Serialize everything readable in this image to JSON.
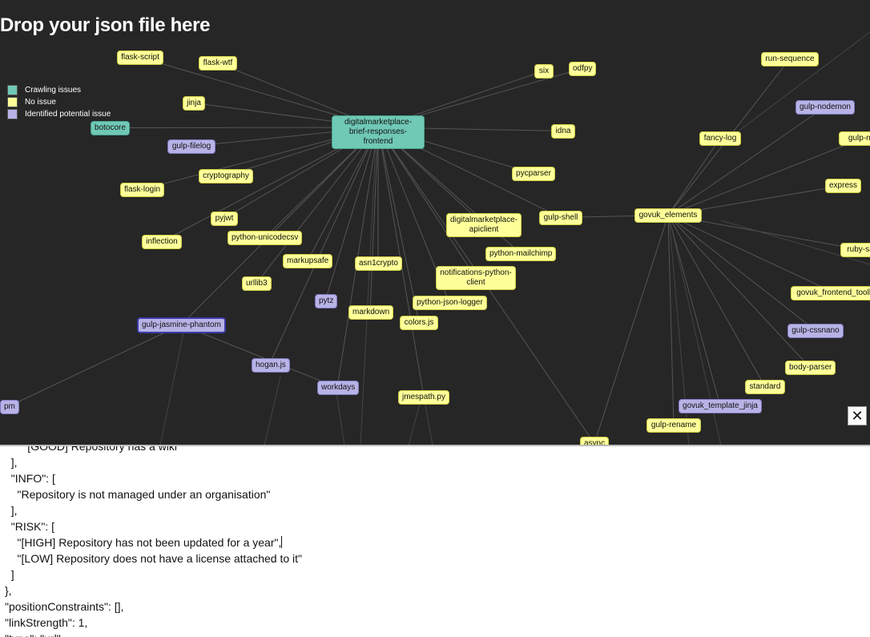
{
  "title": "Drop your json file here",
  "legend": [
    {
      "label": "Crawling issues",
      "color": "#70c9b5"
    },
    {
      "label": "No issue",
      "color": "#ffff99"
    },
    {
      "label": "Identified potential issue",
      "color": "#b7b3e6"
    }
  ],
  "colors": {
    "crawl": "#70c9b5",
    "ok": "#ffff99",
    "risk": "#b7b3e6",
    "background": "#262626",
    "link": "#555555"
  },
  "close_label": "✕",
  "nodes": [
    {
      "id": "digitalmarketplace-brief-responses-frontend",
      "label": "digitalmarketplace-brief-responses-frontend",
      "status": "crawl"
    },
    {
      "id": "flask-script",
      "label": "flask-script",
      "status": "ok"
    },
    {
      "id": "flask-wtf",
      "label": "flask-wtf",
      "status": "ok"
    },
    {
      "id": "jinja",
      "label": "jinja",
      "status": "ok"
    },
    {
      "id": "botocore",
      "label": "botocore",
      "status": "crawl"
    },
    {
      "id": "gulp-filelog",
      "label": "gulp-filelog",
      "status": "risk"
    },
    {
      "id": "cryptography",
      "label": "cryptography",
      "status": "ok"
    },
    {
      "id": "flask-login",
      "label": "flask-login",
      "status": "ok"
    },
    {
      "id": "pyjwt",
      "label": "pyjwt",
      "status": "ok"
    },
    {
      "id": "python-unicodecsv",
      "label": "python-unicodecsv",
      "status": "ok"
    },
    {
      "id": "inflection",
      "label": "inflection",
      "status": "ok"
    },
    {
      "id": "markupsafe",
      "label": "markupsafe",
      "status": "ok"
    },
    {
      "id": "asn1crypto",
      "label": "asn1crypto",
      "status": "ok"
    },
    {
      "id": "urllib3",
      "label": "urllib3",
      "status": "ok"
    },
    {
      "id": "pytz",
      "label": "pytz",
      "status": "risk"
    },
    {
      "id": "markdown",
      "label": "markdown",
      "status": "ok"
    },
    {
      "id": "gulp-jasmine-phantom",
      "label": "gulp-jasmine-phantom",
      "status": "risk",
      "selected": true
    },
    {
      "id": "hogan.js",
      "label": "hogan.js",
      "status": "risk"
    },
    {
      "id": "workdays",
      "label": "workdays",
      "status": "risk"
    },
    {
      "id": "jmespath.py",
      "label": "jmespath.py",
      "status": "ok"
    },
    {
      "id": "pm",
      "label": "pm",
      "status": "risk"
    },
    {
      "id": "six",
      "label": "six",
      "status": "ok"
    },
    {
      "id": "odfpy",
      "label": "odfpy",
      "status": "ok"
    },
    {
      "id": "idna",
      "label": "idna",
      "status": "ok"
    },
    {
      "id": "pycparser",
      "label": "pycparser",
      "status": "ok"
    },
    {
      "id": "digitalmarketplace-apiclient",
      "label": "digitalmarketplace-apiclient",
      "status": "ok"
    },
    {
      "id": "gulp-shell",
      "label": "gulp-shell",
      "status": "ok"
    },
    {
      "id": "python-mailchimp",
      "label": "python-mailchimp",
      "status": "ok"
    },
    {
      "id": "notifications-python-client",
      "label": "notifications-python-client",
      "status": "ok"
    },
    {
      "id": "python-json-logger",
      "label": "python-json-logger",
      "status": "ok"
    },
    {
      "id": "colors.js",
      "label": "colors.js",
      "status": "ok"
    },
    {
      "id": "govuk_elements",
      "label": "govuk_elements",
      "status": "ok"
    },
    {
      "id": "fancy-log",
      "label": "fancy-log",
      "status": "ok"
    },
    {
      "id": "run-sequence",
      "label": "run-sequence",
      "status": "ok"
    },
    {
      "id": "gulp-nodemon",
      "label": "gulp-nodemon",
      "status": "risk"
    },
    {
      "id": "gulp-mo",
      "label": "gulp-mo",
      "status": "ok"
    },
    {
      "id": "express",
      "label": "express",
      "status": "ok"
    },
    {
      "id": "ruby-sa",
      "label": "ruby-sa",
      "status": "ok"
    },
    {
      "id": "govuk_frontend_toolk",
      "label": "govuk_frontend_toolk",
      "status": "ok"
    },
    {
      "id": "gulp-cssnano",
      "label": "gulp-cssnano",
      "status": "risk"
    },
    {
      "id": "body-parser",
      "label": "body-parser",
      "status": "ok"
    },
    {
      "id": "standard",
      "label": "standard",
      "status": "ok"
    },
    {
      "id": "govuk_template_jinja",
      "label": "govuk_template_jinja",
      "status": "risk"
    },
    {
      "id": "gulp-rename",
      "label": "gulp-rename",
      "status": "ok"
    },
    {
      "id": "async",
      "label": "async",
      "status": "ok"
    }
  ],
  "editor_lines": [
    "      \"[GOOD] Repository has a wiki\"",
    "  ],",
    "  \"INFO\": [",
    "    \"Repository is not managed under an organisation\"",
    "  ],",
    "  \"RISK\": [",
    "    \"[HIGH] Repository has not been updated for a year\",",
    "    \"[LOW] Repository does not have a license attached to it\"",
    "  ]",
    "},",
    "\"positionConstraints\": [],",
    "\"linkStrength\": 1,",
    "\"type\": \"url\""
  ]
}
